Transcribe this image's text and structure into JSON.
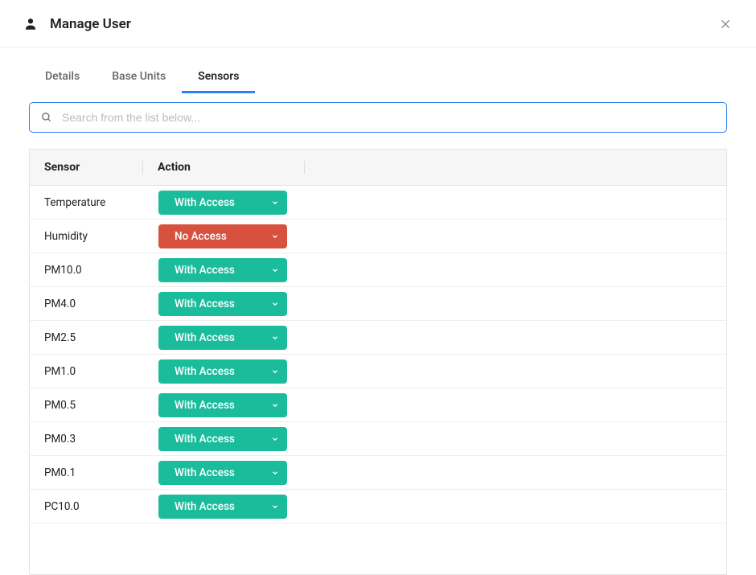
{
  "title": "Manage User",
  "tabs": [
    {
      "label": "Details",
      "active": false
    },
    {
      "label": "Base Units",
      "active": false
    },
    {
      "label": "Sensors",
      "active": true
    }
  ],
  "search": {
    "value": "",
    "placeholder": "Search from the list below..."
  },
  "columns": {
    "sensor": "Sensor",
    "action": "Action"
  },
  "access_options": {
    "with_access": "With Access",
    "no_access": "No Access"
  },
  "rows": [
    {
      "sensor": "Temperature",
      "access": "with_access"
    },
    {
      "sensor": "Humidity",
      "access": "no_access"
    },
    {
      "sensor": "PM10.0",
      "access": "with_access"
    },
    {
      "sensor": "PM4.0",
      "access": "with_access"
    },
    {
      "sensor": "PM2.5",
      "access": "with_access"
    },
    {
      "sensor": "PM1.0",
      "access": "with_access"
    },
    {
      "sensor": "PM0.5",
      "access": "with_access"
    },
    {
      "sensor": "PM0.3",
      "access": "with_access"
    },
    {
      "sensor": "PM0.1",
      "access": "with_access"
    },
    {
      "sensor": "PC10.0",
      "access": "with_access"
    }
  ]
}
